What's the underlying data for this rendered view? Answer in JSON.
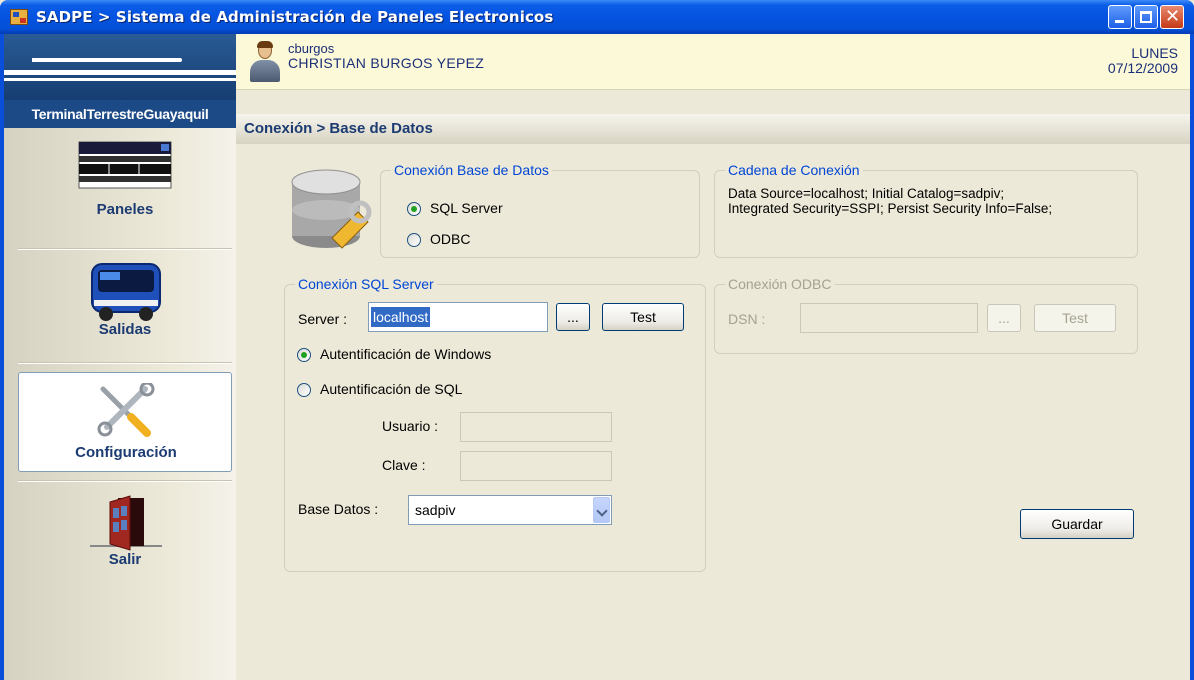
{
  "window": {
    "title": "SADPE > Sistema de Administración de Paneles Electronicos"
  },
  "logo": {
    "text": "TerminalTerrestreGuayaquil"
  },
  "sidebar": {
    "items": [
      {
        "label": "Paneles",
        "icon": "panel-board-icon"
      },
      {
        "label": "Salidas",
        "icon": "bus-icon"
      },
      {
        "label": "Configuración",
        "icon": "tools-icon",
        "selected": true
      },
      {
        "label": "Salir",
        "icon": "door-exit-icon"
      }
    ]
  },
  "user": {
    "username": "cburgos",
    "fullname": "CHRISTIAN BURGOS YEPEZ",
    "day": "LUNES",
    "date": "07/12/2009"
  },
  "breadcrumb": "Conexión > Base de Datos",
  "db_connection": {
    "legend": "Conexión Base de Datos",
    "options": [
      "SQL Server",
      "ODBC"
    ],
    "selected": "SQL Server"
  },
  "connection_string": {
    "legend": "Cadena de Conexión",
    "line1": "Data Source=localhost; Initial Catalog=sadpiv;",
    "line2": "Integrated Security=SSPI; Persist Security Info=False;"
  },
  "sql_server": {
    "legend": "Conexión SQL Server",
    "server_label": "Server :",
    "server_value": "localhost",
    "browse_label": "...",
    "test_label": "Test",
    "auth_windows": "Autentificación de Windows",
    "auth_sql": "Autentificación de SQL",
    "auth_selected": "Autentificación de Windows",
    "user_label": "Usuario :",
    "user_value": "",
    "password_label": "Clave :",
    "password_value": "",
    "database_label": "Base Datos :",
    "database_value": "sadpiv"
  },
  "odbc": {
    "legend": "Conexión ODBC",
    "dsn_label": "DSN :",
    "dsn_value": "",
    "browse_label": "...",
    "test_label": "Test"
  },
  "save_label": "Guardar",
  "colors": {
    "titlebar": "#0553e0",
    "legend": "#0046d5",
    "nav_text": "#1c3b72",
    "header_bg": "#fcf9d8"
  }
}
